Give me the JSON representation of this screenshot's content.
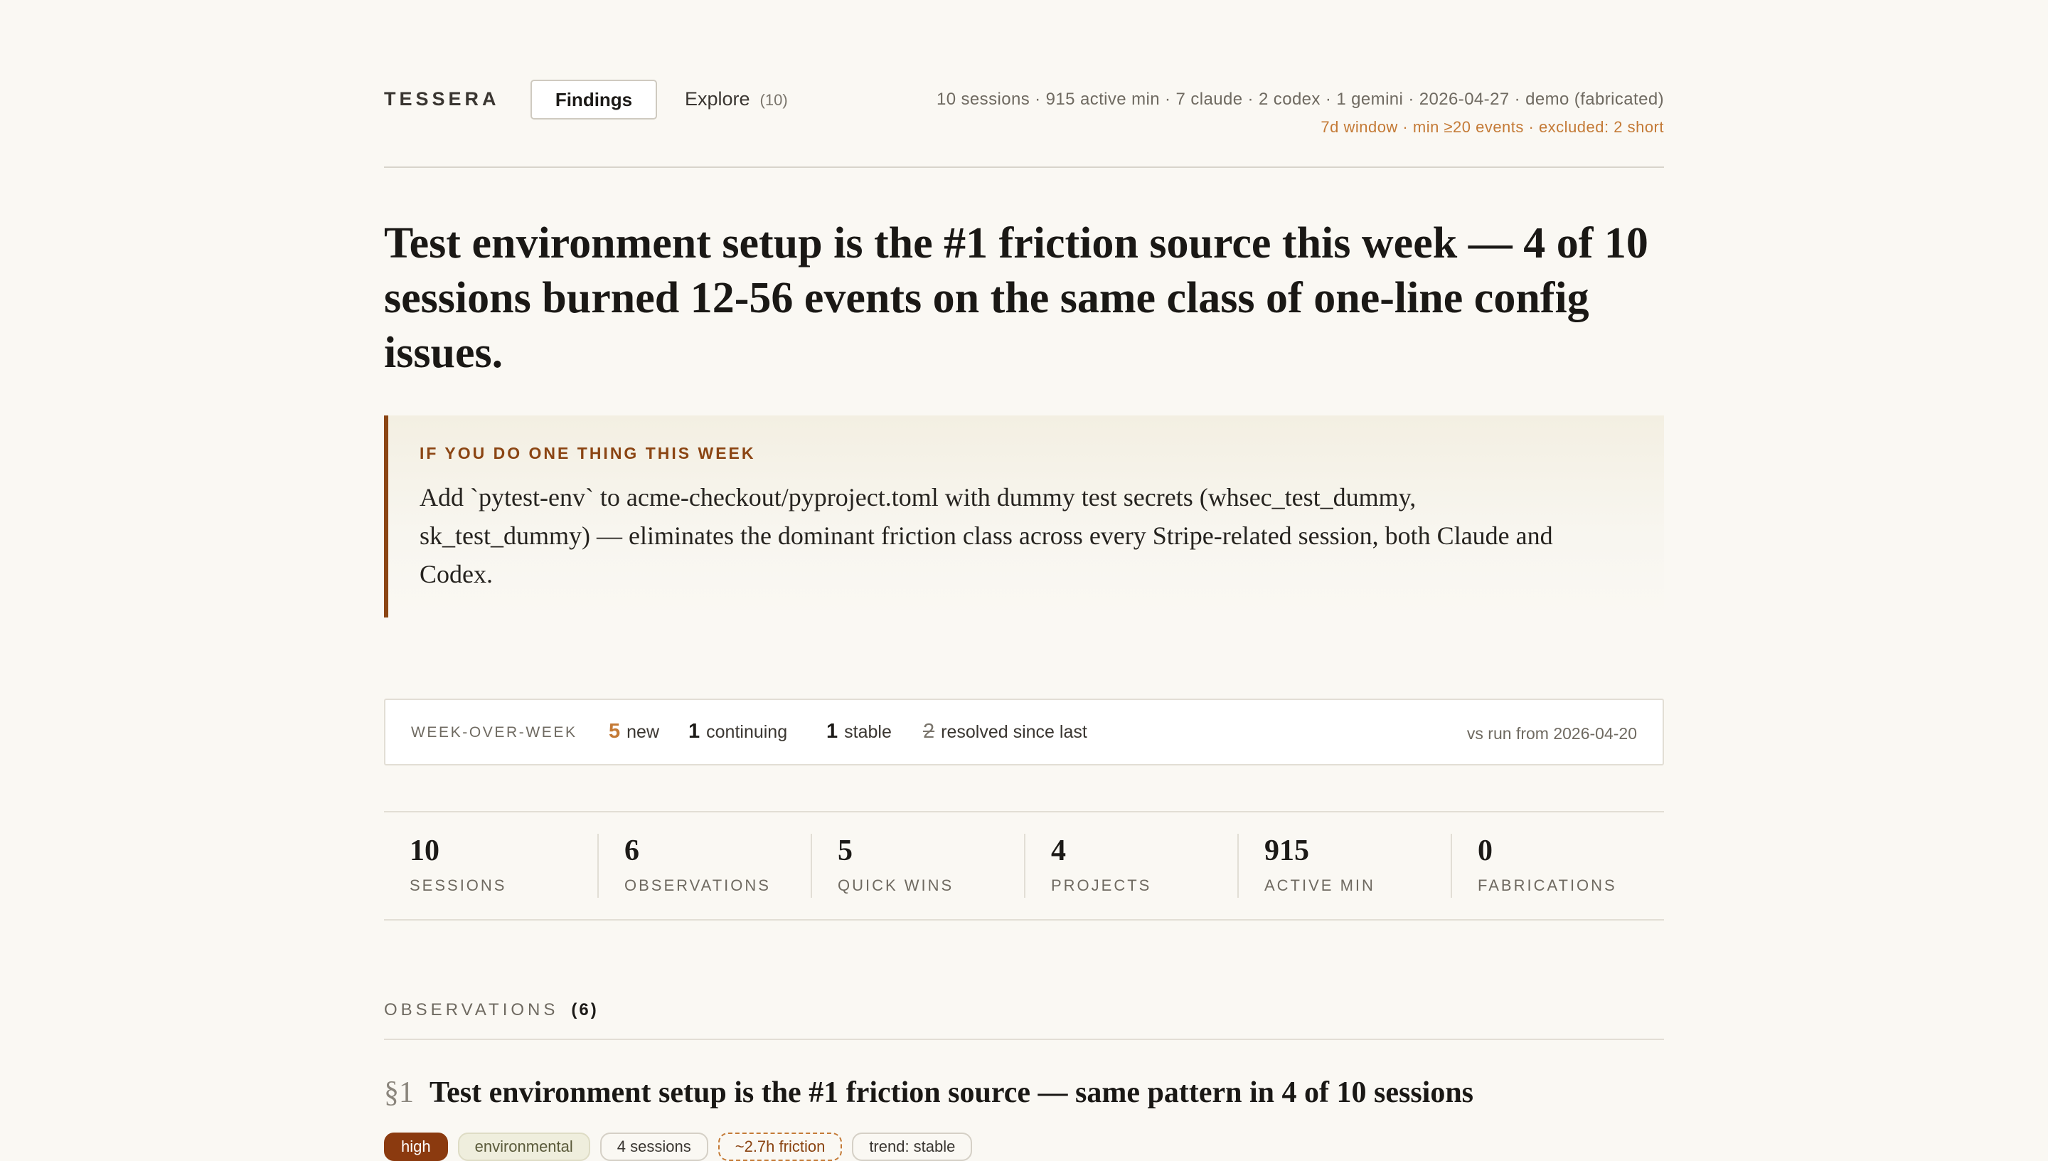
{
  "header": {
    "brand": "TESSERA",
    "tabs": [
      {
        "label": "Findings",
        "active": true
      },
      {
        "label": "Explore",
        "count": "(10)"
      }
    ],
    "meta_line1": "10 sessions · 915 active min · 7 claude · 2 codex · 1 gemini · 2026-04-27 · demo (fabricated)",
    "meta_line2": "7d window · min ≥20 events · excluded: 2 short"
  },
  "headline": "Test environment setup is the #1 friction source this week — 4 of 10 sessions burned 12-56 events on the same class of one-line config issues.",
  "callout": {
    "label": "IF YOU DO ONE THING THIS WEEK",
    "text": "Add `pytest-env` to acme-checkout/pyproject.toml with dummy test secrets (whsec_test_dummy, sk_test_dummy) — eliminates the dominant friction class across every Stripe-related session, both Claude and Codex."
  },
  "week_over_week": {
    "label": "WEEK-OVER-WEEK",
    "items": [
      {
        "num": "5",
        "text": "new"
      },
      {
        "num": "1",
        "text": "continuing"
      },
      {
        "num": "1",
        "text": "stable"
      },
      {
        "num": "2",
        "text": "resolved since last"
      }
    ],
    "compare": "vs run from 2026-04-20"
  },
  "stats": [
    {
      "value": "10",
      "label": "SESSIONS"
    },
    {
      "value": "6",
      "label": "OBSERVATIONS"
    },
    {
      "value": "5",
      "label": "QUICK WINS"
    },
    {
      "value": "4",
      "label": "PROJECTS"
    },
    {
      "value": "915",
      "label": "ACTIVE MIN"
    },
    {
      "value": "0",
      "label": "FABRICATIONS"
    }
  ],
  "observations": {
    "label": "OBSERVATIONS",
    "count": "(6)",
    "items": [
      {
        "section": "§1",
        "title": "Test environment setup is the #1 friction source — same pattern in 4 of 10 sessions",
        "tags": [
          "high",
          "environmental",
          "4 sessions",
          "~2.7h friction",
          "trend: stable"
        ]
      }
    ]
  },
  "colors": {
    "background": "#faf8f3",
    "accent": "#8b4513",
    "accent_light": "#c47a36",
    "tag_high": "#8b3a0f"
  }
}
